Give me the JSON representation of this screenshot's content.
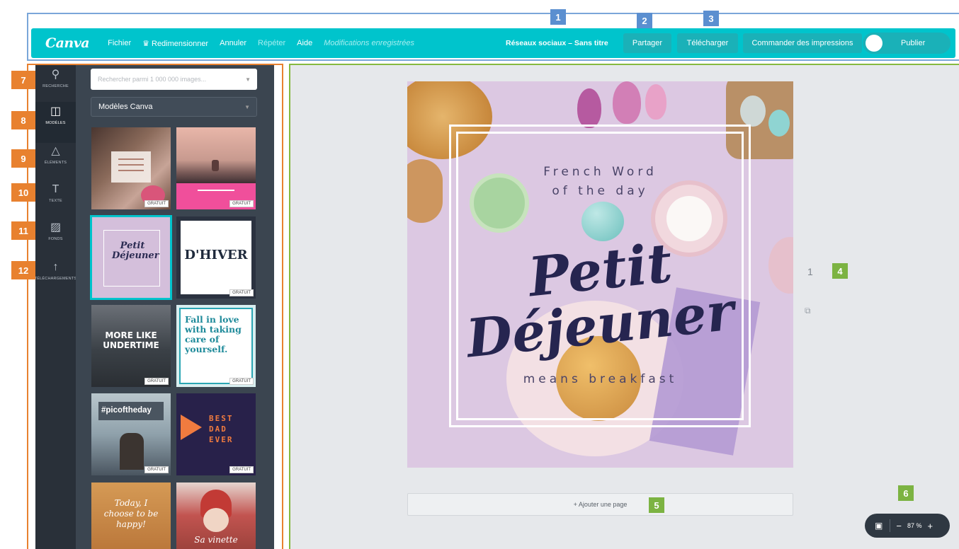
{
  "markers": [
    "1",
    "2",
    "3",
    "4",
    "5",
    "6",
    "7",
    "8",
    "9",
    "10",
    "11",
    "12"
  ],
  "topbar": {
    "logo": "Canva",
    "menu": [
      "Fichier",
      "Redimensionner",
      "Annuler",
      "Répéter",
      "Aide"
    ],
    "crown_icon": "crown-icon",
    "status": "Modifications enregistrées",
    "doc_title": "Réseaux sociaux – Sans titre",
    "share": "Partager",
    "download": "Télécharger",
    "order_prints": "Commander des impressions",
    "publish": "Publier"
  },
  "rail": [
    {
      "label": "RECHERCHE",
      "icon": "search-icon"
    },
    {
      "label": "MODÈLES",
      "icon": "layout-icon"
    },
    {
      "label": "ÉLÉMENTS",
      "icon": "shapes-icon"
    },
    {
      "label": "TEXTE",
      "icon": "text-icon"
    },
    {
      "label": "FONDS",
      "icon": "pattern-icon"
    },
    {
      "label": "TÉLÉCHARGEMENTS",
      "icon": "upload-icon"
    }
  ],
  "panel": {
    "search_placeholder": "Rechercher parmi 1 000 000 images...",
    "select_value": "Modèles Canva",
    "badge": "GRATUIT",
    "tiles": {
      "t4": "D'HIVER",
      "t5": "MORE LIKE UNDERTIME",
      "t6": "Fall in love with taking care of yourself.",
      "t7": "#picoftheday",
      "t8": "BEST DAD EVER",
      "t3": "Petit Déjeuner",
      "t9": "Today, I choose to be happy!",
      "t10": "Sa vinette"
    }
  },
  "design": {
    "line1": "French Word",
    "line2": "of the day",
    "main1": "Petit",
    "main2": "Déjeuner",
    "sub": "means breakfast"
  },
  "canvas": {
    "page_number": "1",
    "add_page": "+ Ajouter une page",
    "zoom": "87 %"
  }
}
